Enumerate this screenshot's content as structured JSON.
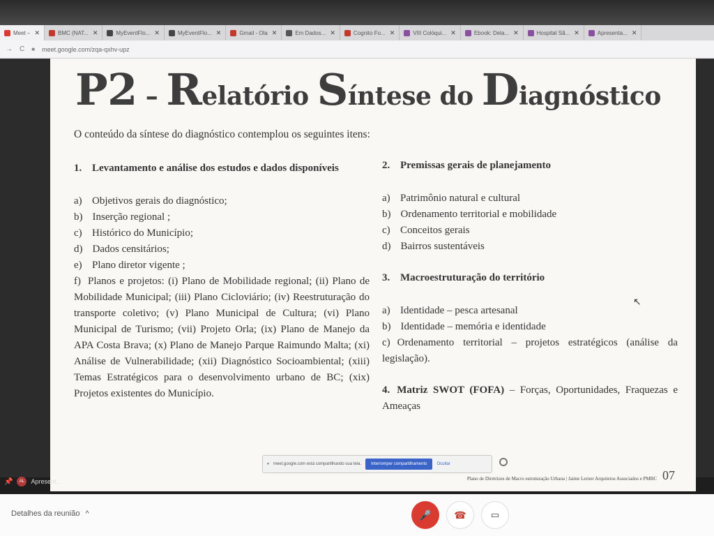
{
  "browser": {
    "tabs": [
      {
        "label": "Meet –",
        "color": "#d93b30",
        "icon": "meet-icon"
      },
      {
        "label": "BMC (NAT...",
        "color": "#c0392b",
        "icon": "gmail-icon"
      },
      {
        "label": "MyEventFlo...",
        "color": "#444444",
        "icon": "globe-icon"
      },
      {
        "label": "MyEventFlo...",
        "color": "#444444",
        "icon": "globe-icon"
      },
      {
        "label": "Gmail - Ola",
        "color": "#c0392b",
        "icon": "gmail-icon"
      },
      {
        "label": "Em Dados...",
        "color": "#555555",
        "icon": "doc-icon"
      },
      {
        "label": "Cognito Fo...",
        "color": "#c0392b",
        "icon": "cognito-icon"
      },
      {
        "label": "VIII Colóqui...",
        "color": "#8a4f9e",
        "icon": "site-icon"
      },
      {
        "label": "Ebook: Dela...",
        "color": "#8a4f9e",
        "icon": "site-icon"
      },
      {
        "label": "Hospital Sã...",
        "color": "#8a4f9e",
        "icon": "site-icon"
      },
      {
        "label": "Apresenta...",
        "color": "#8a4f9e",
        "icon": "site-icon"
      }
    ],
    "url": "meet.google.com/zqa-qxhv-upz"
  },
  "slide": {
    "title_parts": [
      {
        "text": "P2",
        "big": true
      },
      {
        "text": " – ",
        "big": false
      },
      {
        "text": "R",
        "big": true
      },
      {
        "text": "elatório ",
        "big": false
      },
      {
        "text": "S",
        "big": true
      },
      {
        "text": "íntese do ",
        "big": false
      },
      {
        "text": "D",
        "big": true
      },
      {
        "text": "iagnóstico",
        "big": false
      }
    ],
    "intro": "O conteúdo da síntese do diagnóstico contemplou os seguintes itens:",
    "left": {
      "number": "1.",
      "heading": "Levantamento e análise dos estudos e dados disponíveis",
      "items": [
        {
          "letter": "a)",
          "text": "Objetivos gerais do diagnóstico;"
        },
        {
          "letter": "b)",
          "text": "Inserção regional ;"
        },
        {
          "letter": "c)",
          "text": "Histórico do Município;"
        },
        {
          "letter": "d)",
          "text": "Dados censitários;"
        },
        {
          "letter": "e)",
          "text": "Plano diretor vigente ;"
        }
      ],
      "item_f_letter": "f)",
      "item_f_text": "Planos e projetos: (i) Plano de Mobilidade regional; (ii) Plano de Mobilidade Municipal; (iii) Plano Cicloviário; (iv) Reestruturação do transporte coletivo; (v) Plano Municipal de Cultura; (vi) Plano Municipal de Turismo; (vii) Projeto Orla; (ix) Plano de Manejo da APA Costa Brava; (x) Plano de Manejo Parque Raimundo Malta; (xi) Análise de Vulnerabilidade; (xii) Diagnóstico Socioambiental; (xiii) Temas Estratégicos para o desenvolvimento urbano de BC; (xix) Projetos existentes do Município."
    },
    "right": {
      "s2": {
        "number": "2.",
        "heading": "Premissas gerais de planejamento",
        "items": [
          {
            "letter": "a)",
            "text": "Patrimônio natural e cultural"
          },
          {
            "letter": "b)",
            "text": "Ordenamento territorial e mobilidade"
          },
          {
            "letter": "c)",
            "text": "Conceitos gerais"
          },
          {
            "letter": "d)",
            "text": "Bairros sustentáveis"
          }
        ]
      },
      "s3": {
        "number": "3.",
        "heading": "Macroestruturação do território",
        "items": [
          {
            "letter": "a)",
            "text": "Identidade – pesca artesanal"
          },
          {
            "letter": "b)",
            "text": "Identidade – memória e identidade"
          }
        ],
        "item_c_letter": "c)",
        "item_c_text": "Ordenamento territorial – projetos estratégicos (análise da legislação)."
      },
      "s4": {
        "number": "4.",
        "heading": "Matriz SWOT (FOFA)",
        "rest": " – Forças, Oportunidades, Fraquezas e Ameaças"
      }
    },
    "footer_text": "Plano de Diretrizes de Macro estruturação Urbana | Jaime Lerner Arquitetos Associados e PMBC",
    "page_number": "07"
  },
  "share_banner": {
    "message": "meet.google.com está compartilhando sua tela.",
    "stop_label": "Interromper compartilhamento",
    "hide_label": "Ocultar"
  },
  "presenter": {
    "label": "Apresent...",
    "avatar": "AL"
  },
  "meet": {
    "details_label": "Detalhes da reunião",
    "colors": {
      "mic_off": "#d93b30",
      "accent": "#3b64c9"
    }
  }
}
